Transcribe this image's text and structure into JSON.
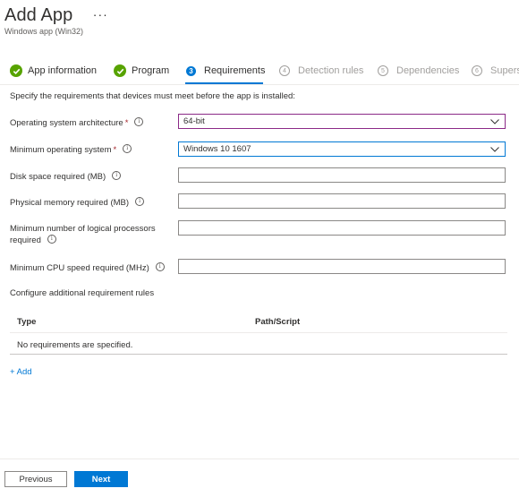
{
  "header": {
    "title": "Add App",
    "subtitle": "Windows app (Win32)",
    "more_label": "···"
  },
  "steps": [
    {
      "number": "",
      "label": "App information",
      "state": "done",
      "icon": "checkmark-icon"
    },
    {
      "number": "",
      "label": "Program",
      "state": "done",
      "icon": "checkmark-icon"
    },
    {
      "number": "3",
      "label": "Requirements",
      "state": "active"
    },
    {
      "number": "4",
      "label": "Detection rules",
      "state": "pending"
    },
    {
      "number": "5",
      "label": "Dependencies",
      "state": "pending"
    },
    {
      "number": "6",
      "label": "Superse",
      "state": "pending"
    }
  ],
  "description": "Specify the requirements that devices must meet before the app is installed:",
  "form": {
    "os_arch": {
      "label": "Operating system architecture",
      "required": "*",
      "value": "64-bit"
    },
    "min_os": {
      "label": "Minimum operating system",
      "required": "*",
      "value": "Windows 10 1607"
    },
    "disk_space": {
      "label": "Disk space required (MB)",
      "value": ""
    },
    "physical_memory": {
      "label": "Physical memory required (MB)",
      "value": ""
    },
    "logical_processors": {
      "label_line1": "Minimum number of logical processors",
      "label_line2": "required",
      "value": ""
    },
    "cpu_speed": {
      "label": "Minimum CPU speed required (MHz)",
      "value": ""
    }
  },
  "info_glyph": "i",
  "additional": {
    "heading": "Configure additional requirement rules",
    "columns": [
      "Type",
      "Path/Script"
    ],
    "empty_text": "No requirements are specified.",
    "add_label": "+ Add"
  },
  "footer": {
    "previous_label": "Previous",
    "next_label": "Next"
  },
  "colors": {
    "accent": "#0078d4",
    "done": "#57a300",
    "required": "#a4262c"
  }
}
